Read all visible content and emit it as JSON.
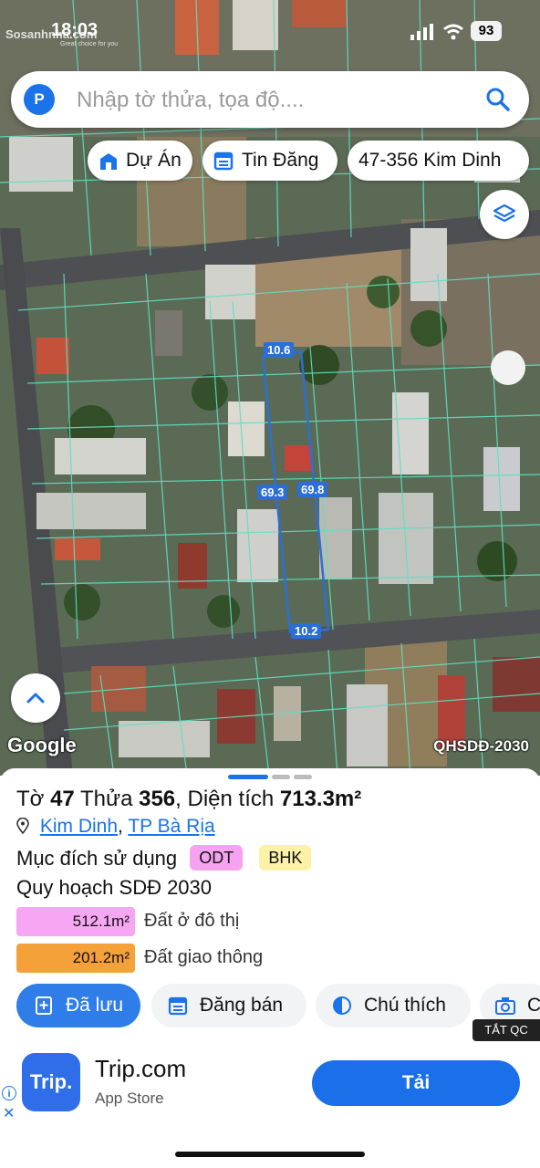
{
  "status_bar": {
    "time": "18:03",
    "battery": "93"
  },
  "watermark": {
    "brand": "Sosanhnha.com",
    "tagline": "Great choice for you"
  },
  "search": {
    "logo_letter": "P",
    "placeholder": "Nhập tờ thửa, tọa độ...."
  },
  "chips": [
    {
      "label": "Dự Án",
      "icon": "building-icon"
    },
    {
      "label": "Tin Đăng",
      "icon": "calendar-icon"
    },
    {
      "label": "47-356 Kim Dinh",
      "icon": ""
    }
  ],
  "map": {
    "edge_labels": {
      "top": "10.6",
      "left": "69.3",
      "right": "69.8",
      "bottom": "10.2"
    },
    "attribution": "Google",
    "layer_name": "QHSDĐ-2030",
    "colors": {
      "parcel_lines": "#5fe0c0",
      "selected_plot": "#2b6fd6"
    }
  },
  "parcel": {
    "sheet_label": "Tờ",
    "sheet_no": "47",
    "plot_label": "Thửa",
    "plot_no": "356",
    "area_label": ", Diện tích",
    "area": "713.3m²",
    "ward": "Kim Dinh",
    "city": "TP Bà Rịa",
    "usage_label": "Mục đích sử dụng",
    "usage_tags": [
      {
        "code": "ODT",
        "color": "#f5a3f0"
      },
      {
        "code": "BHK",
        "color": "#fbf2a8"
      }
    ],
    "plan_label": "Quy hoạch SDĐ 2030",
    "breakdown": [
      {
        "area": "512.1m²",
        "label": "Đất ở đô thị",
        "color": "#f6a6f2"
      },
      {
        "area": "201.2m²",
        "label": "Đất giao thông",
        "color": "#f5a13a"
      }
    ]
  },
  "actions": [
    {
      "label": "Đã lưu",
      "icon": "bookmark-icon"
    },
    {
      "label": "Đăng bán",
      "icon": "calendar-icon"
    },
    {
      "label": "Chú thích",
      "icon": "half-circle-icon"
    },
    {
      "label": "C",
      "icon": "camera-icon"
    }
  ],
  "ad_toggle": "TẮT QC",
  "ad": {
    "logo_text": "Trip.",
    "name": "Trip.com",
    "store": "App Store",
    "cta": "Tải"
  },
  "pager": {
    "count": 3,
    "active": 0
  }
}
